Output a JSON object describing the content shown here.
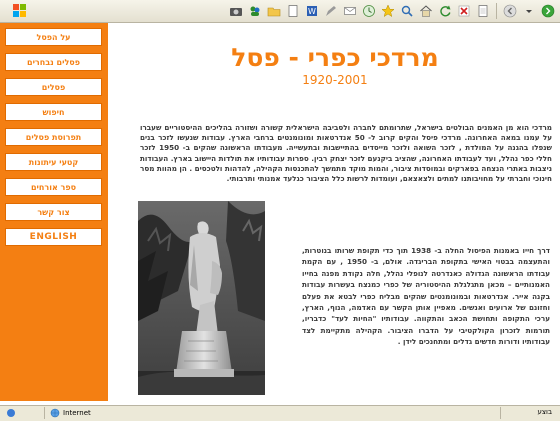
{
  "toolbar": {
    "icons": [
      "windows-logo",
      "back",
      "forward",
      "refresh",
      "home",
      "favorites",
      "history",
      "mail",
      "print",
      "word",
      "edit",
      "folder",
      "messenger",
      "camera"
    ]
  },
  "sidebar": {
    "items": [
      {
        "label": "על הפסל"
      },
      {
        "label": "פסלים נבחרים"
      },
      {
        "label": "פסלים"
      },
      {
        "label": "חיפוש"
      },
      {
        "label": "תפרוסת פסלים"
      },
      {
        "label": "קטעי עיתונות"
      },
      {
        "label": "ספר אורחים"
      },
      {
        "label": "צור קשר"
      },
      {
        "label": "ENGLISH"
      }
    ]
  },
  "main": {
    "title": "מרדכי כפרי - פסל",
    "years": "1920-2001",
    "paragraph1": "מרדכי הוא מן האמנים הבולטים בישראל, שתרומתם לחברה ולסביבה הישראלית קשורה ושזורה בהליכים ההיסטוריים שעברו על עמנו במאה האחרונה. מרדכי פיסל והקים קרוב ל- 50 אנדרטאות ומונומנטים ברחבי הארץ. עבודות שנעשו לזכר בנים שנפלו בהגנה על המולדת , לזכר השואה ולזכר מייסדים בהתיישבות ובתעשייה. מעבודתו הראשונה שהקים ב- 1950 לזכר חללי כפר נהלל, ועד לעבודתו האחרונה, שהציב ביקנעם לזכר יצחק רבין. ספרות עבודותיו את תולדות היישוב בארץ. העבודות ניצבות באתרי הנצחה בפארקים ובמוסדות ציבור, והמות מוקד מתמשך להתכנסות הקהילה, להדהות ולטכסים . הן מהוות מסר חינוכי וחברתי על מחויבותנו למתים ולצאצאם, ועומדות לרשות כלל הציבור כגלעד אמנותי ותרבותי.",
    "paragraph2": "דרך חייו באמנות הפיסול החלה ב- 1938 תוך כדי תקופת שרותו בנוטרות, והתעצמה בבטוי האישי בתקופת הבריגדה. אולם, ב- 1950 , עם הקמת עבודתו הראשונה הגדולה כאנדרטה לנופלי נהלל, חלה נקודת מפנה בחייו האמנותיים – מכאן מתגלגלת ההיסטוריה של כפרי כמנצח בעשרות עבודות בקנה אייר. אנדרטאות ובמונומנטים שהקים מבליח כפרי לבטא את פעלם וחזונם של ארועים ואנשים. מאפיין אותן הקשר עם האדמה, הנוף, הארץ, ערכי התקופה ותחושת הכאב והתקווה. עבודותיו \"החיות לעד\" כדבריו, תורמות לזכרון הקולקטיבי על הדברו הציבור. הקהילה מתקיימת לצד עבודותיו ודורות חדשים גדלים ומתחנכים לידן ."
  },
  "statusbar": {
    "zone": "Internet",
    "status": "בוצע"
  },
  "colors": {
    "accent": "#f47f12",
    "text": "#3a3a3a"
  }
}
